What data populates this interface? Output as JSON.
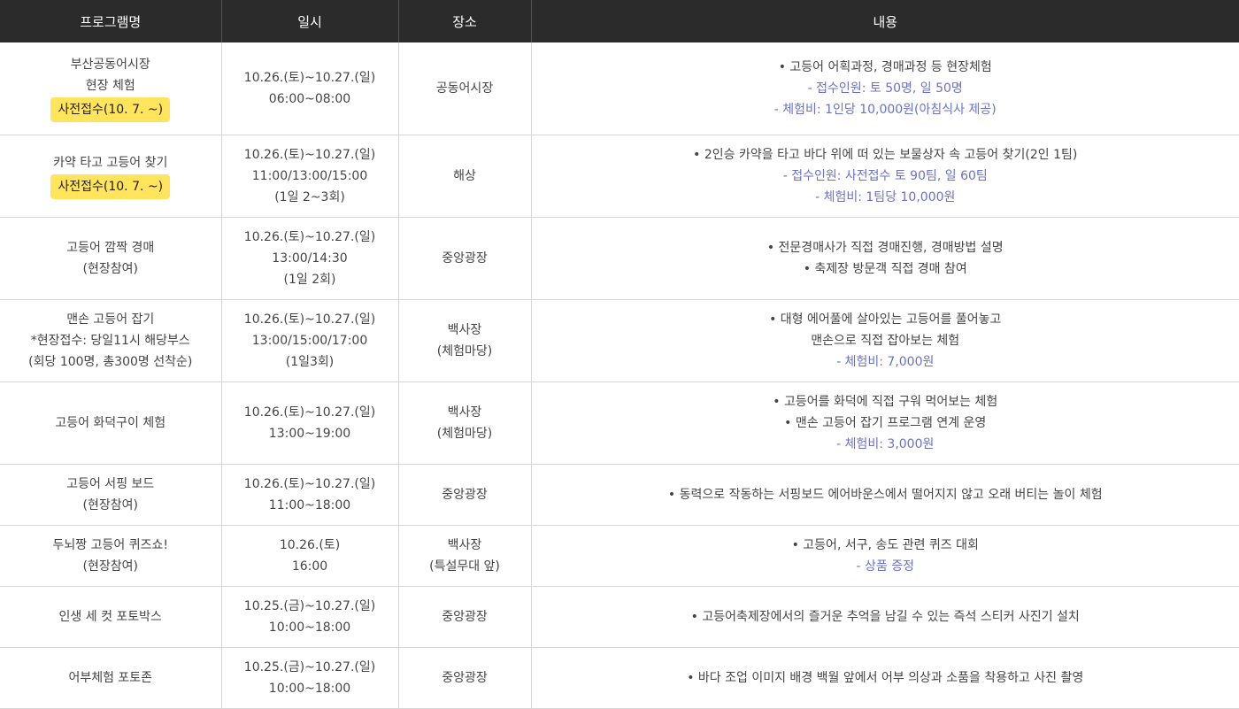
{
  "headers": {
    "program": "프로그램명",
    "datetime": "일시",
    "place": "장소",
    "content": "내용"
  },
  "rows": [
    {
      "program": [
        "부산공동어시장",
        "현장 체험"
      ],
      "badge": "사전접수(10. 7. ~)",
      "datetime": [
        "10.26.(토)~10.27.(일)",
        "06:00~08:00"
      ],
      "place": [
        "공동어시장"
      ],
      "content": [
        "• 고등어 어획과정, 경매과정 등 현장체험"
      ],
      "content_blue": [
        "- 접수인원: 토 50명, 일 50명",
        "- 체험비: 1인당 10,000원(아침식사 제공)"
      ]
    },
    {
      "program": [
        "카약 타고 고등어 찾기"
      ],
      "badge": "사전접수(10. 7. ~)",
      "datetime": [
        "10.26.(토)~10.27.(일)",
        "11:00/13:00/15:00",
        "(1일 2~3회)"
      ],
      "place": [
        "해상"
      ],
      "content": [
        "• 2인승 카약을 타고 바다 위에 떠 있는 보물상자 속 고등어 찾기(2인 1팀)"
      ],
      "content_blue": [
        "- 접수인원: 사전접수 토 90팀, 일 60팀",
        "- 체험비: 1팀당 10,000원"
      ]
    },
    {
      "program": [
        "고등어 깜짝 경매",
        "(현장참여)"
      ],
      "badge": "",
      "datetime": [
        "10.26.(토)~10.27.(일)",
        "13:00/14:30",
        "(1일 2회)"
      ],
      "place": [
        "중앙광장"
      ],
      "content": [
        "• 전문경매사가 직접 경매진행, 경매방법 설명",
        "• 축제장 방문객 직접 경매 참여"
      ],
      "content_blue": []
    },
    {
      "program": [
        "맨손 고등어 잡기",
        "*현장접수: 당일11시 해당부스",
        "(회당 100명, 총300명 선착순)"
      ],
      "badge": "",
      "datetime": [
        "10.26.(토)~10.27.(일)",
        "13:00/15:00/17:00",
        "(1일3회)"
      ],
      "place": [
        "백사장",
        "(체험마당)"
      ],
      "content": [
        "• 대형 에어풀에 살아있는 고등어를 풀어놓고",
        "맨손으로 직접 잡아보는 체험"
      ],
      "content_blue": [
        "- 체험비: 7,000원"
      ]
    },
    {
      "program": [
        "고등어 화덕구이 체험"
      ],
      "badge": "",
      "datetime": [
        "10.26.(토)~10.27.(일)",
        "13:00~19:00"
      ],
      "place": [
        "백사장",
        "(체험마당)"
      ],
      "content": [
        "• 고등어를 화덕에 직접 구워 먹어보는 체험",
        "• 맨손 고등어 잡기 프로그램 연계 운영"
      ],
      "content_blue": [
        "- 체험비: 3,000원"
      ]
    },
    {
      "program": [
        "고등어 서핑 보드",
        "(현장참여)"
      ],
      "badge": "",
      "datetime": [
        "10.26.(토)~10.27.(일)",
        "11:00~18:00"
      ],
      "place": [
        "중앙광장"
      ],
      "content": [
        "• 동력으로 작동하는 서핑보드 에어바운스에서 떨어지지 않고 오래 버티는 놀이 체험"
      ],
      "content_blue": []
    },
    {
      "program": [
        "두뇌짱 고등어 퀴즈쇼!",
        "(현장참여)"
      ],
      "badge": "",
      "datetime": [
        "10.26.(토)",
        "16:00"
      ],
      "place": [
        "백사장",
        "(특설무대 앞)"
      ],
      "content": [
        "• 고등어, 서구, 송도 관련 퀴즈 대회"
      ],
      "content_blue": [
        "- 상품 증정"
      ]
    },
    {
      "program": [
        "인생 세 컷 포토박스"
      ],
      "badge": "",
      "datetime": [
        "10.25.(금)~10.27.(일)",
        "10:00~18:00"
      ],
      "place": [
        "중앙광장"
      ],
      "content": [
        "• 고등어축제장에서의 즐거운 추억을 남길 수 있는 즉석 스티커 사진기 설치"
      ],
      "content_blue": []
    },
    {
      "program": [
        "어부체험 포토존"
      ],
      "badge": "",
      "datetime": [
        "10.25.(금)~10.27.(일)",
        "10:00~18:00"
      ],
      "place": [
        "중앙광장"
      ],
      "content": [
        "• 바다 조업 이미지 배경 백월 앞에서 어부 의상과 소품을 착용하고 사진 촬영"
      ],
      "content_blue": []
    }
  ]
}
